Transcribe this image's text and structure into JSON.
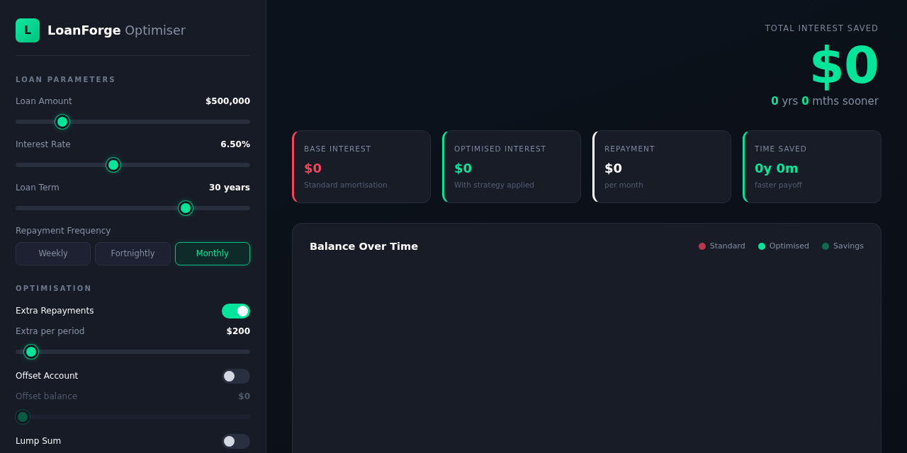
{
  "brand": {
    "logo_letter": "L",
    "title": "**LoanForge** Optimiser"
  },
  "loan_parameters": {
    "heading": "LOAN PARAMETERS",
    "sliders": [
      {
        "label": "Loan Amount",
        "value": "$500,000",
        "level": 0.18
      },
      {
        "label": "Interest Rate",
        "value": "6.50%",
        "level": 0.41
      },
      {
        "label": "Loan Term",
        "value": "30 years",
        "level": 0.74
      }
    ],
    "frequency": {
      "label": "Repayment Frequency",
      "options": [
        {
          "label": "Weekly",
          "selected": false
        },
        {
          "label": "Fortnightly",
          "selected": false
        },
        {
          "label": "Monthly",
          "selected": true
        }
      ]
    }
  },
  "optimisation": {
    "heading": "OPTIMISATION",
    "options": [
      {
        "label": "Extra Repayments",
        "on": true,
        "slider": {
          "label": "Extra per period",
          "value": "$200",
          "level": 0.04
        }
      },
      {
        "label": "Offset Account",
        "on": false,
        "slider": {
          "label": "Offset balance",
          "value": "$0",
          "level": 0
        }
      },
      {
        "label": "Lump Sum",
        "on": false
      }
    ]
  },
  "summary": {
    "label": "TOTAL INTEREST SAVED",
    "amount": "$0",
    "sooner": "**0** yrs **0** mths sooner"
  },
  "stats": [
    {
      "label": "BASE INTEREST",
      "value": "$0",
      "note": "Standard amortisation",
      "color": "#f4455c"
    },
    {
      "label": "OPTIMISED INTEREST",
      "value": "$0",
      "note": "With strategy applied",
      "color": "#00e59a"
    },
    {
      "label": "REPAYMENT",
      "value": "$0",
      "note": "per month",
      "color": "#ffffff"
    },
    {
      "label": "TIME SAVED",
      "value": "0y 0m",
      "note": "faster payoff",
      "color": "#00e59a"
    }
  ],
  "chart": {
    "title": "Balance Over Time",
    "legend": [
      {
        "label": "Standard",
        "color": "#b8374a"
      },
      {
        "label": "Optimised",
        "color": "#00e59a"
      },
      {
        "label": "Savings",
        "color": "#0f6b4f"
      }
    ]
  }
}
